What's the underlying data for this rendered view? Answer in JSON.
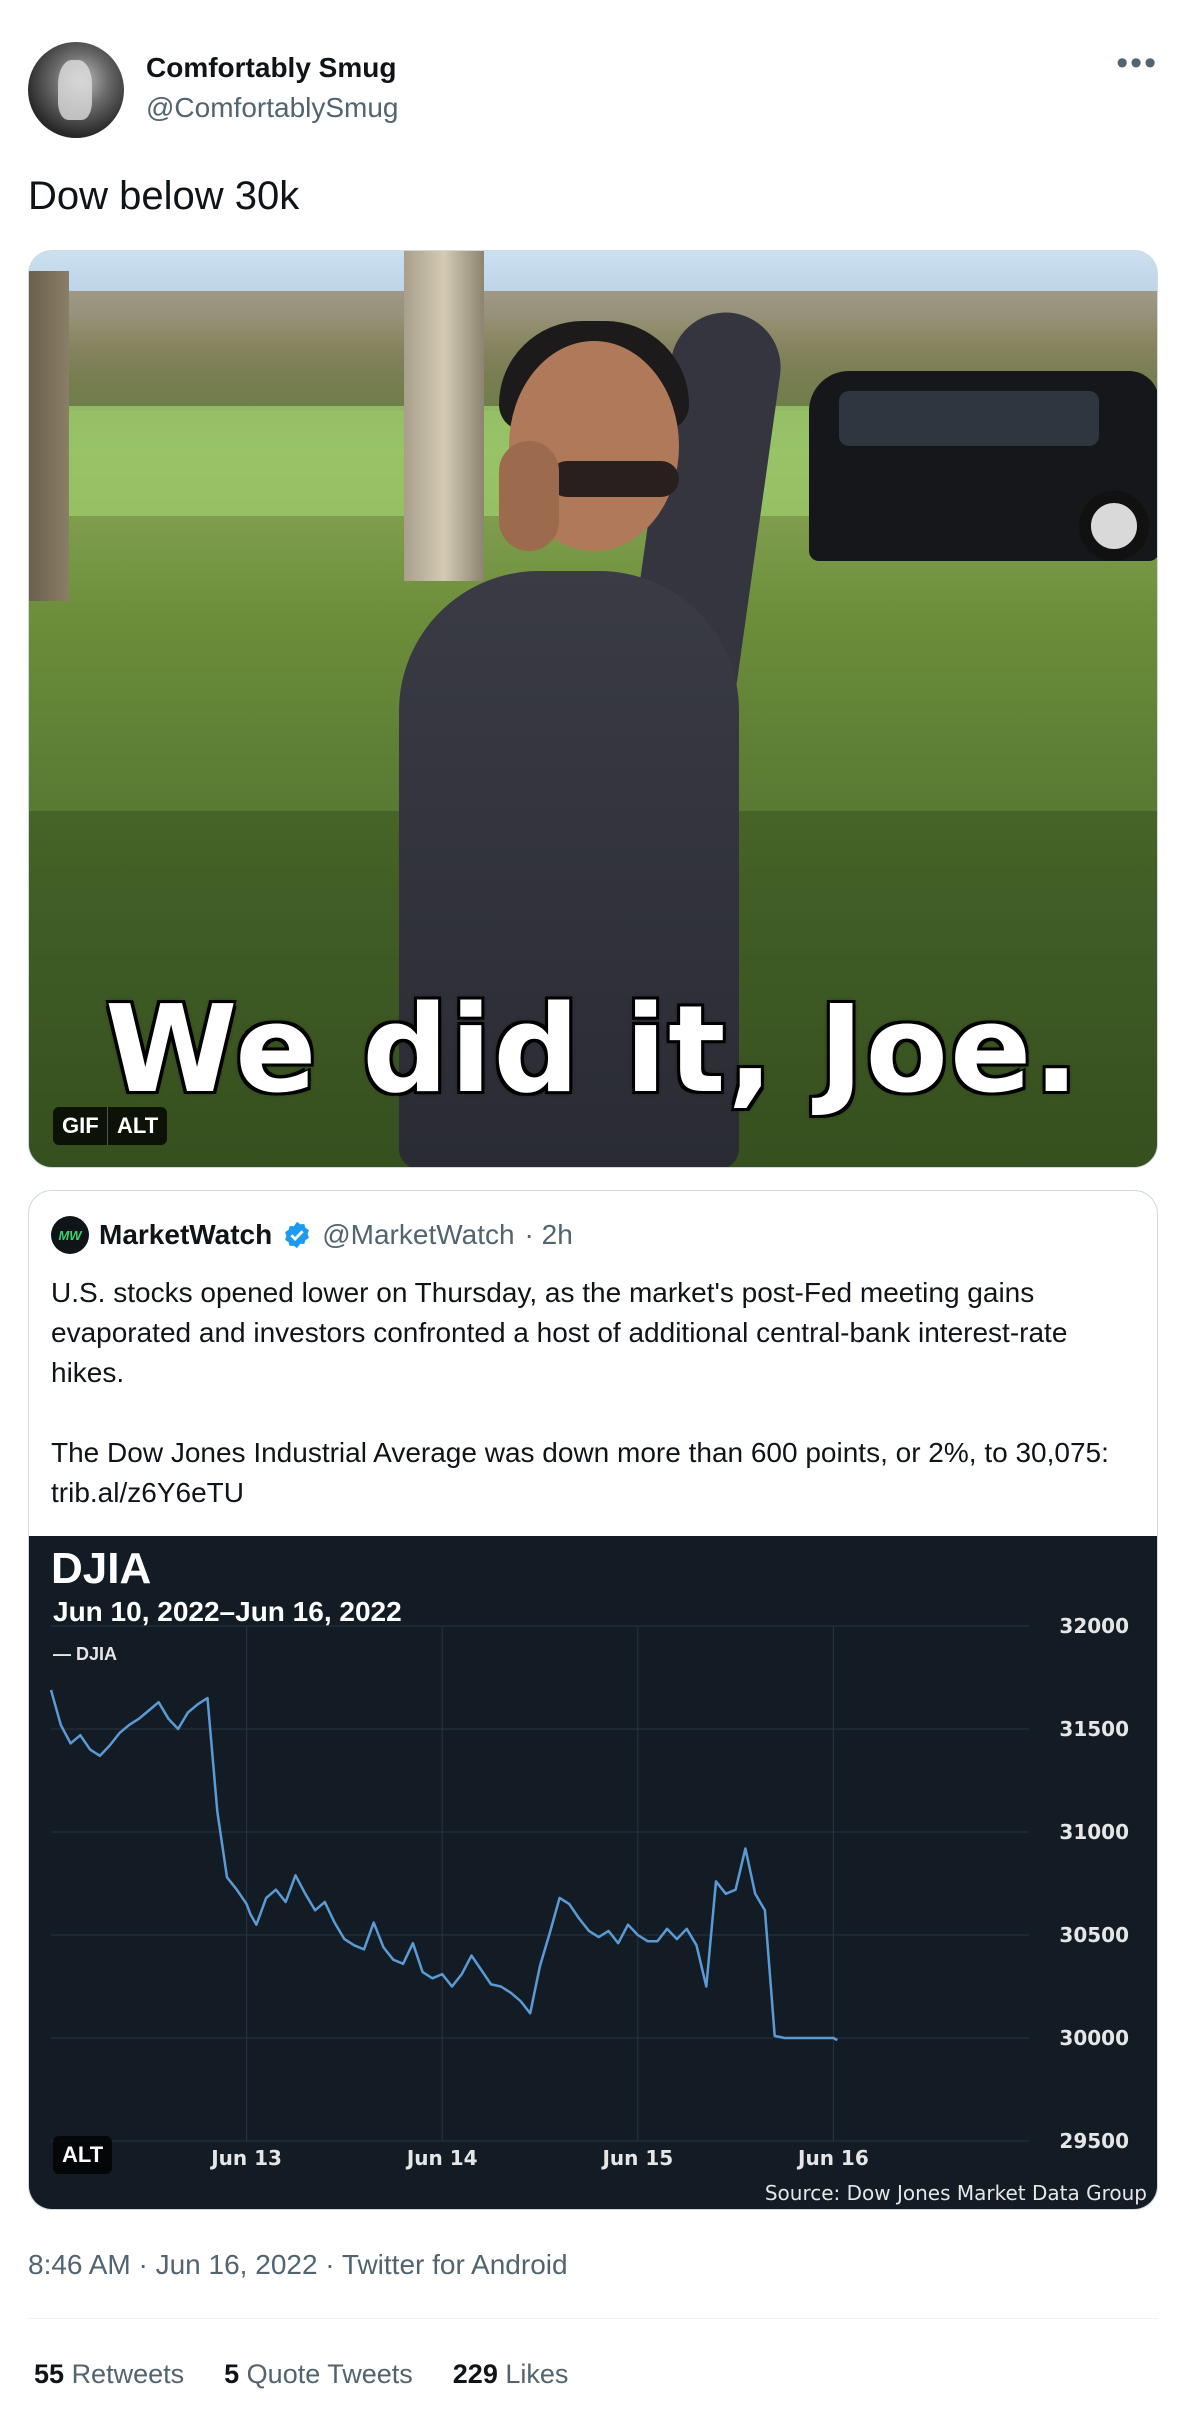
{
  "author": {
    "display_name": "Comfortably Smug",
    "handle": "@ComfortablySmug"
  },
  "more_icon": "more-horizontal-icon",
  "tweet_text": "Dow below 30k",
  "gif": {
    "caption": "We did it, Joe.",
    "badge_gif": "GIF",
    "badge_alt": "ALT"
  },
  "quote": {
    "name": "MarketWatch",
    "handle": "@MarketWatch",
    "time": "· 2h",
    "logo_text": "MW",
    "paragraph1": "U.S. stocks opened lower on Thursday, as the market's post-Fed meeting gains evaporated and investors confronted a host of additional central-bank interest-rate hikes.",
    "paragraph2": "The Dow Jones Industrial Average was down more than 600 points, or 2%, to 30,075: trib.al/z6Y6eTU",
    "alt_badge": "ALT"
  },
  "chart_data": {
    "type": "line",
    "title": "DJIA",
    "subtitle": "Jun 10, 2022–Jun 16, 2022",
    "legend": "DJIA",
    "source": "Source: Dow Jones Market Data Group",
    "x_ticks": [
      "Jun 13",
      "Jun 14",
      "Jun 15",
      "Jun 16"
    ],
    "y_ticks": [
      32000,
      31500,
      31000,
      30500,
      30000,
      29500
    ],
    "ylim": [
      29500,
      32000
    ],
    "grid": true,
    "legend_position": "top-left",
    "colors": {
      "line": "#5b9bd5",
      "background": "#131c25",
      "grid": "#2a3541"
    },
    "series": [
      {
        "name": "DJIA",
        "x": [
          0,
          0.05,
          0.1,
          0.15,
          0.2,
          0.25,
          0.3,
          0.35,
          0.4,
          0.45,
          0.5,
          0.55,
          0.6,
          0.65,
          0.7,
          0.75,
          0.8,
          0.85,
          0.9,
          0.95,
          1.0,
          1.02,
          1.05,
          1.1,
          1.15,
          1.2,
          1.25,
          1.3,
          1.35,
          1.4,
          1.45,
          1.5,
          1.55,
          1.6,
          1.65,
          1.7,
          1.75,
          1.8,
          1.85,
          1.9,
          1.95,
          2.0,
          2.05,
          2.1,
          2.15,
          2.2,
          2.25,
          2.3,
          2.35,
          2.4,
          2.45,
          2.5,
          2.55,
          2.6,
          2.65,
          2.7,
          2.75,
          2.8,
          2.85,
          2.9,
          2.95,
          3.0,
          3.05,
          3.1,
          3.15,
          3.2,
          3.25,
          3.3,
          3.35,
          3.4,
          3.45,
          3.5,
          3.55,
          3.6,
          3.65,
          3.7,
          3.75,
          3.8,
          3.85,
          3.88,
          3.9,
          3.92,
          3.95,
          3.98,
          4.0,
          4.02
        ],
        "y": [
          31690,
          31520,
          31430,
          31470,
          31400,
          31370,
          31420,
          31480,
          31520,
          31550,
          31590,
          31630,
          31550,
          31500,
          31580,
          31620,
          31650,
          31100,
          30780,
          30720,
          30650,
          30600,
          30550,
          30680,
          30720,
          30660,
          30790,
          30700,
          30620,
          30660,
          30560,
          30480,
          30450,
          30430,
          30560,
          30440,
          30380,
          30360,
          30460,
          30320,
          30290,
          30310,
          30250,
          30310,
          30400,
          30330,
          30260,
          30250,
          30220,
          30180,
          30120,
          30350,
          30510,
          30680,
          30650,
          30580,
          30520,
          30490,
          30520,
          30460,
          30550,
          30500,
          30470,
          30470,
          30530,
          30480,
          30530,
          30450,
          30250,
          30760,
          30700,
          30720,
          30920,
          30700,
          30620,
          30010,
          30000,
          30000,
          30000,
          30000,
          30000,
          30000,
          30000,
          30000,
          30000,
          29990
        ]
      }
    ]
  },
  "timestamp": "8:46 AM · Jun 16, 2022 · Twitter for Android",
  "stats": {
    "retweets_count": "55",
    "retweets_label": "Retweets",
    "quotes_count": "5",
    "quotes_label": "Quote Tweets",
    "likes_count": "229",
    "likes_label": "Likes"
  }
}
